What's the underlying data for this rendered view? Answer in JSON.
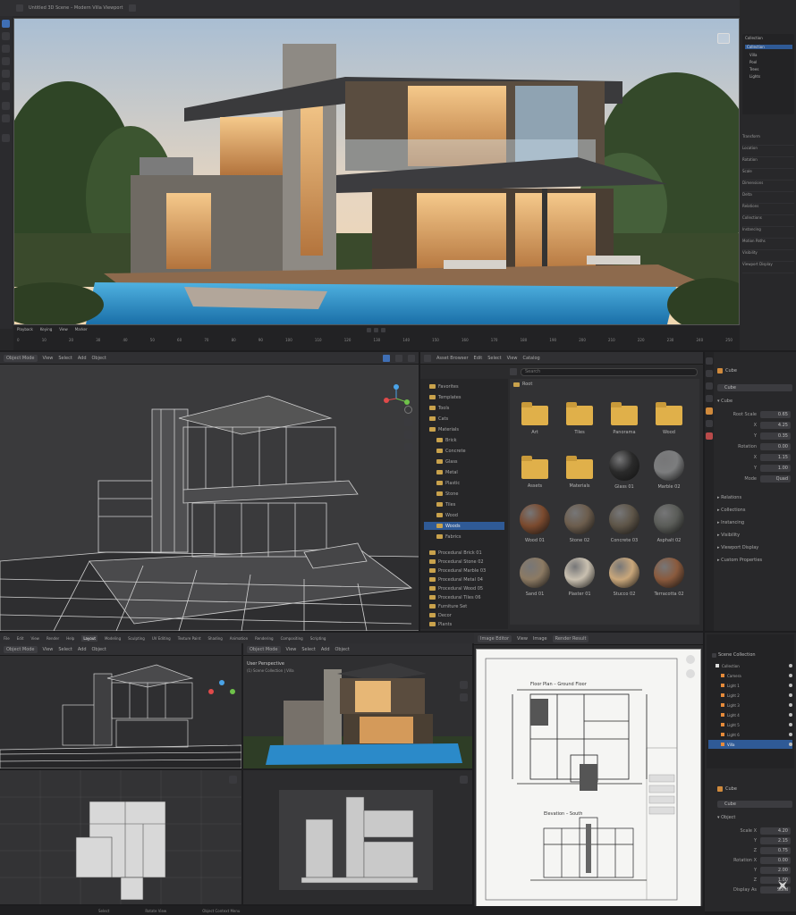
{
  "top_window": {
    "title": "Untitled 3D Scene – Modern Villa Viewport",
    "timeline_labels": [
      "Playback",
      "Keying",
      "View",
      "Marker"
    ],
    "frame_numbers": [
      "0",
      "10",
      "20",
      "30",
      "40",
      "50",
      "60",
      "70",
      "80",
      "90",
      "100",
      "110",
      "120",
      "130",
      "140",
      "150",
      "160",
      "170",
      "180",
      "190",
      "200",
      "210",
      "220",
      "230",
      "240",
      "250"
    ]
  },
  "right_top_panel": {
    "outliner_title": "Collection",
    "outliner_items": [
      "Collection",
      "Villa",
      "Pool",
      "Trees",
      "Lights"
    ],
    "sections": [
      "Transform",
      "Location",
      "Rotation",
      "Scale",
      "Dimensions",
      "Delta",
      "Relations",
      "Collections",
      "Instancing",
      "Motion Paths",
      "Visibility",
      "Viewport Display"
    ]
  },
  "wireframe_panel": {
    "header": [
      "Object Mode",
      "View",
      "Select",
      "Add",
      "Object"
    ]
  },
  "asset_browser": {
    "header": [
      "Asset Browser",
      "Edit",
      "Select",
      "View",
      "Catalog"
    ],
    "search_placeholder": "Search",
    "path_label": "Root",
    "tree": [
      "Favorites",
      "Templates",
      "Tools",
      "Cats",
      "Materials",
      "Brick",
      "Concrete",
      "Glass",
      "Metal",
      "Plastic",
      "Stone",
      "Tiles",
      "Wood",
      "Woods",
      "Fabrics"
    ],
    "tree_more": [
      "Procedural Brick 01",
      "Procedural Stone 02",
      "Procedural Marble 03",
      "Procedural Metal 04",
      "Procedural Wood 05",
      "Procedural Tiles 06",
      "Furniture Set",
      "Decor",
      "Plants",
      "Lighting"
    ],
    "selected_index": 13,
    "assets": [
      {
        "name": "Art",
        "kind": "folder"
      },
      {
        "name": "Tiles",
        "kind": "folder"
      },
      {
        "name": "Panorama",
        "kind": "folder"
      },
      {
        "name": "Wood",
        "kind": "folder"
      },
      {
        "name": "Assets",
        "kind": "folder"
      },
      {
        "name": "Materials",
        "kind": "folder"
      },
      {
        "name": "Glass 01",
        "kind": "sphere",
        "color": "#2a2a2a"
      },
      {
        "name": "Marble 02",
        "kind": "sphere",
        "color": "#7c7d7e"
      },
      {
        "name": "Wood 01",
        "kind": "sphere",
        "color": "#7b4a2e"
      },
      {
        "name": "Stone 02",
        "kind": "sphere",
        "color": "#6c5d4d"
      },
      {
        "name": "Concrete 03",
        "kind": "sphere",
        "color": "#5e5548"
      },
      {
        "name": "Asphalt 02",
        "kind": "sphere",
        "color": "#5a5c58"
      },
      {
        "name": "Sand 01",
        "kind": "sphere",
        "color": "#8c7a63"
      },
      {
        "name": "Plaster 01",
        "kind": "sphere",
        "color": "#c9c0b0"
      },
      {
        "name": "Stucco 02",
        "kind": "sphere",
        "color": "#c9a77b"
      },
      {
        "name": "Terracotta 02",
        "kind": "sphere",
        "color": "#8a5a3d"
      }
    ]
  },
  "properties_mid": {
    "title": "Cube",
    "object_name": "Cube",
    "section": "Cube",
    "fields": [
      {
        "label": "Root Scale",
        "value": "0.65"
      },
      {
        "label": "X",
        "value": "4.25"
      },
      {
        "label": "Y",
        "value": "0.35"
      },
      {
        "label": "Rotation",
        "value": "0.00"
      },
      {
        "label": "X",
        "value": "1.15"
      },
      {
        "label": "Y",
        "value": "1.00"
      },
      {
        "label": "Mode",
        "value": "Quad"
      }
    ],
    "collapsed": [
      "Relations",
      "Collections",
      "Instancing",
      "Visibility",
      "Viewport Display",
      "Custom Properties"
    ]
  },
  "bottom_menu": [
    "File",
    "Edit",
    "View",
    "Render",
    "Help",
    "Layout",
    "Modeling",
    "Sculpting",
    "UV Editing",
    "Texture Paint",
    "Shading",
    "Animation",
    "Rendering",
    "Compositing",
    "Scripting"
  ],
  "bottom_panels": {
    "wire2_header": [
      "Object Mode",
      "View",
      "Select",
      "Add",
      "Object"
    ],
    "render_header": [
      "Object Mode",
      "View",
      "Select",
      "Add",
      "Object"
    ],
    "render_caption": "User Perspective",
    "render_sub": "(1) Scene Collection | Villa",
    "drawing_header": [
      "Image Editor",
      "View",
      "Image",
      "Render Result"
    ],
    "drawing_title": "Floor Plan – Ground Floor",
    "drawing_sub": "Elevation – South"
  },
  "right_bottom": {
    "outliner_title": "Scene Collection",
    "outliner_items": [
      "Collection",
      "Camera",
      "Light 1",
      "Light 2",
      "Light 3",
      "Light 4",
      "Light 5",
      "Light 6",
      "Villa"
    ],
    "props_title": "Cube",
    "props_field": "Cube",
    "props_section": "Object",
    "fields": [
      {
        "label": "Scale X",
        "value": "4.20"
      },
      {
        "label": "Y",
        "value": "2.15"
      },
      {
        "label": "Z",
        "value": "0.75"
      },
      {
        "label": "Rotation X",
        "value": "0.00"
      },
      {
        "label": "Y",
        "value": "2.00"
      },
      {
        "label": "Z",
        "value": "1.00"
      },
      {
        "label": "Display As",
        "value": "Solid"
      }
    ]
  },
  "status_bar": [
    "Select",
    "Rotate View",
    "Object Context Menu"
  ]
}
